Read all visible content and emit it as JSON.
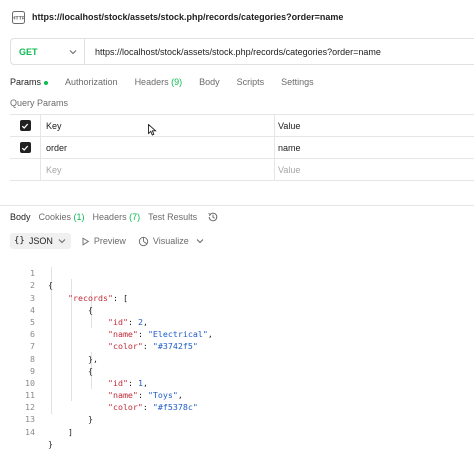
{
  "title": "https://localhost/stock/assets/stock.php/records/categories?order=name",
  "request": {
    "method": "GET",
    "url": "https://localhost/stock/assets/stock.php/records/categories?order=name"
  },
  "request_tabs": [
    {
      "label": "Params",
      "active": true
    },
    {
      "label": "Authorization"
    },
    {
      "label": "Headers",
      "count": "(9)"
    },
    {
      "label": "Body"
    },
    {
      "label": "Scripts"
    },
    {
      "label": "Settings"
    }
  ],
  "query_params": {
    "section_label": "Query Params",
    "headers": {
      "key": "Key",
      "value": "Value"
    },
    "rows": [
      {
        "key": "order",
        "value": "name",
        "checked": true
      }
    ],
    "placeholder": {
      "key": "Key",
      "value": "Value"
    }
  },
  "response_tabs": [
    {
      "label": "Body",
      "active": true
    },
    {
      "label": "Cookies",
      "count": "(1)"
    },
    {
      "label": "Headers",
      "count": "(7)"
    },
    {
      "label": "Test Results"
    }
  ],
  "response_toolbar": {
    "format_braces": "{}",
    "format_label": "JSON",
    "preview_label": "Preview",
    "visualize_label": "Visualize"
  },
  "response_body": {
    "line_numbers": [
      "1",
      "2",
      "3",
      "4",
      "5",
      "6",
      "7",
      "8",
      "9",
      "10",
      "11",
      "12",
      "13",
      "14"
    ],
    "records": [
      {
        "id": "2",
        "name": "\"Electrical\"",
        "color": "\"#3742f5\""
      },
      {
        "id": "1",
        "name": "\"Toys\"",
        "color": "\"#f5378c\""
      }
    ],
    "keys": {
      "records": "\"records\"",
      "id": "\"id\"",
      "name": "\"name\"",
      "color": "\"color\""
    }
  },
  "colors": {
    "accent_green": "#0cbb52",
    "json_key": "#c12b39",
    "json_value": "#1d5cc9"
  }
}
